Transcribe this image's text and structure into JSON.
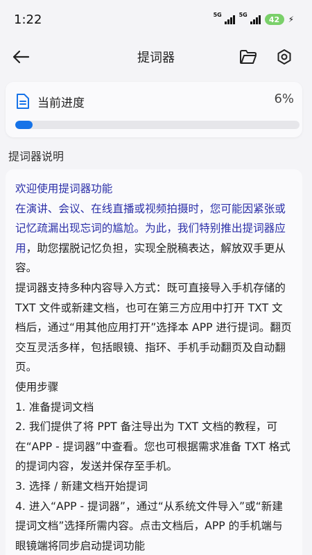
{
  "status": {
    "time": "1:22",
    "signal1": "5G",
    "signal2": "5G",
    "battery": "42"
  },
  "appbar": {
    "title": "提词器",
    "back_icon": "arrow-left-icon",
    "folder_icon": "folder-icon",
    "settings_icon": "settings-icon"
  },
  "progress": {
    "label": "当前进度",
    "percent_text": "6%",
    "value": 0.06,
    "accent": "#1673e8"
  },
  "section": {
    "title": "提词器说明"
  },
  "description": {
    "welcome": "欢迎使用提词器功能",
    "intro_highlight": "在演讲、会议、在线直播或视频拍摄时，您可能因紧张或记忆疏漏出现忘词的尴尬。为此，我们特别推出提词器应用",
    "intro_rest": "，助您摆脱记忆负担，实现全脱稿表达，解放双手更从容。",
    "para2": "提词器支持多种内容导入方式：既可直接导入手机存储的 TXT 文件或新建文档，也可在第三方应用中打开 TXT 文档后，通过“用其他应用打开”选择本 APP 进行提词。翻页交互灵活多样，包括眼镜、指环、手机手动翻页及自动翻页。",
    "steps_title": "使用步骤",
    "step1": "1. 准备提词文档",
    "step2": "2. 我们提供了将 PPT 备注导出为 TXT 文档的教程，可在“APP - 提词器”中查看。您也可根据需求准备 TXT 格式的提词内容，发送并保存至手机。",
    "step3": "3. 选择 / 新建文档开始提词",
    "step4": "4. 进入“APP - 提词器”，通过“从系统文件导入”或“新建提词文档”选择所需内容。点击文档后，APP 的手机端与眼镜端将同步启动提词功能"
  },
  "colors": {
    "highlight": "#2b2fa8",
    "background": "#f4f4f7",
    "card": "#fafafc"
  }
}
